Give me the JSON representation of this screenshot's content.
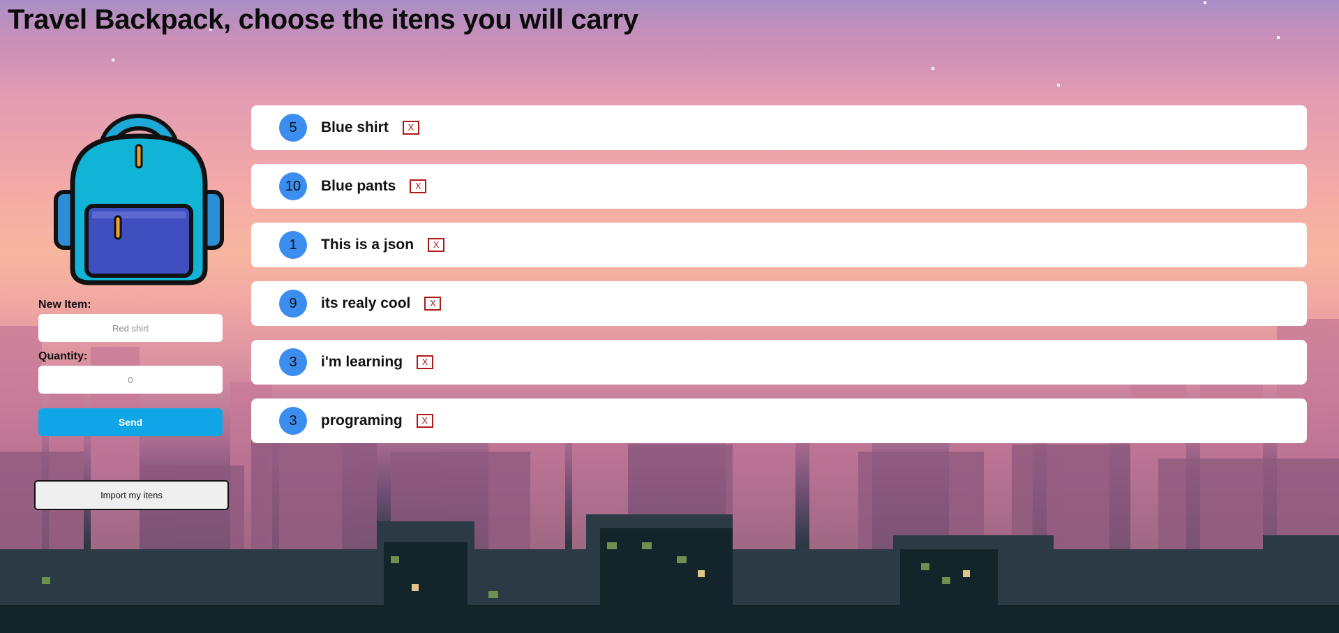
{
  "header": {
    "title": "Travel Backpack, choose the itens you will carry"
  },
  "form": {
    "item_label": "New Item:",
    "item_placeholder": "Red shirt",
    "quantity_label": "Quantity:",
    "quantity_placeholder": "0",
    "send_label": "Send"
  },
  "import": {
    "label": "Import my itens"
  },
  "items": [
    {
      "quantity": "5",
      "name": "Blue shirt",
      "remove": "X"
    },
    {
      "quantity": "10",
      "name": "Blue pants",
      "remove": "X"
    },
    {
      "quantity": "1",
      "name": "This is a json",
      "remove": "X"
    },
    {
      "quantity": "9",
      "name": "its realy cool",
      "remove": "X"
    },
    {
      "quantity": "3",
      "name": "i'm learning",
      "remove": "X"
    },
    {
      "quantity": "3",
      "name": "programing",
      "remove": "X"
    }
  ],
  "icons": {
    "backpack": "backpack-icon"
  },
  "colors": {
    "accent": "#10a5e6",
    "badge": "#3b8ef0",
    "remove": "#b01818"
  }
}
